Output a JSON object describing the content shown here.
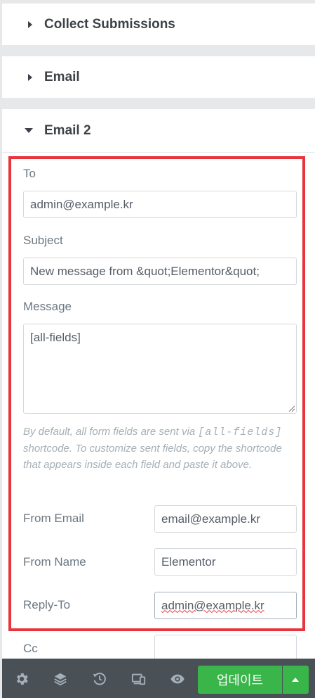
{
  "sections": {
    "collect_submissions": "Collect Submissions",
    "email": "Email",
    "email2": "Email 2"
  },
  "fields": {
    "to_label": "To",
    "to_value": "admin@example.kr",
    "subject_label": "Subject",
    "subject_value": "New message from &quot;Elementor&quot;",
    "message_label": "Message",
    "message_value": "[all-fields]",
    "help_pre": "By default, all form fields are sent via ",
    "help_code": "[all-fields]",
    "help_post": " shortcode. To customize sent fields, copy the shortcode that appears inside each field and paste it above.",
    "from_email_label": "From Email",
    "from_email_value": "email@example.kr",
    "from_name_label": "From Name",
    "from_name_value": "Elementor",
    "reply_to_label": "Reply-To",
    "reply_to_value": "admin@example.kr",
    "cc_label": "Cc",
    "cc_value": ""
  },
  "toolbar": {
    "icons": [
      "gear-icon",
      "layers-icon",
      "history-icon",
      "responsive-icon",
      "eye-icon"
    ],
    "update_label": "업데이트"
  },
  "colors": {
    "accent_green": "#39b54a",
    "highlight_red": "#e8343b",
    "toolbar_bg": "#495157"
  }
}
